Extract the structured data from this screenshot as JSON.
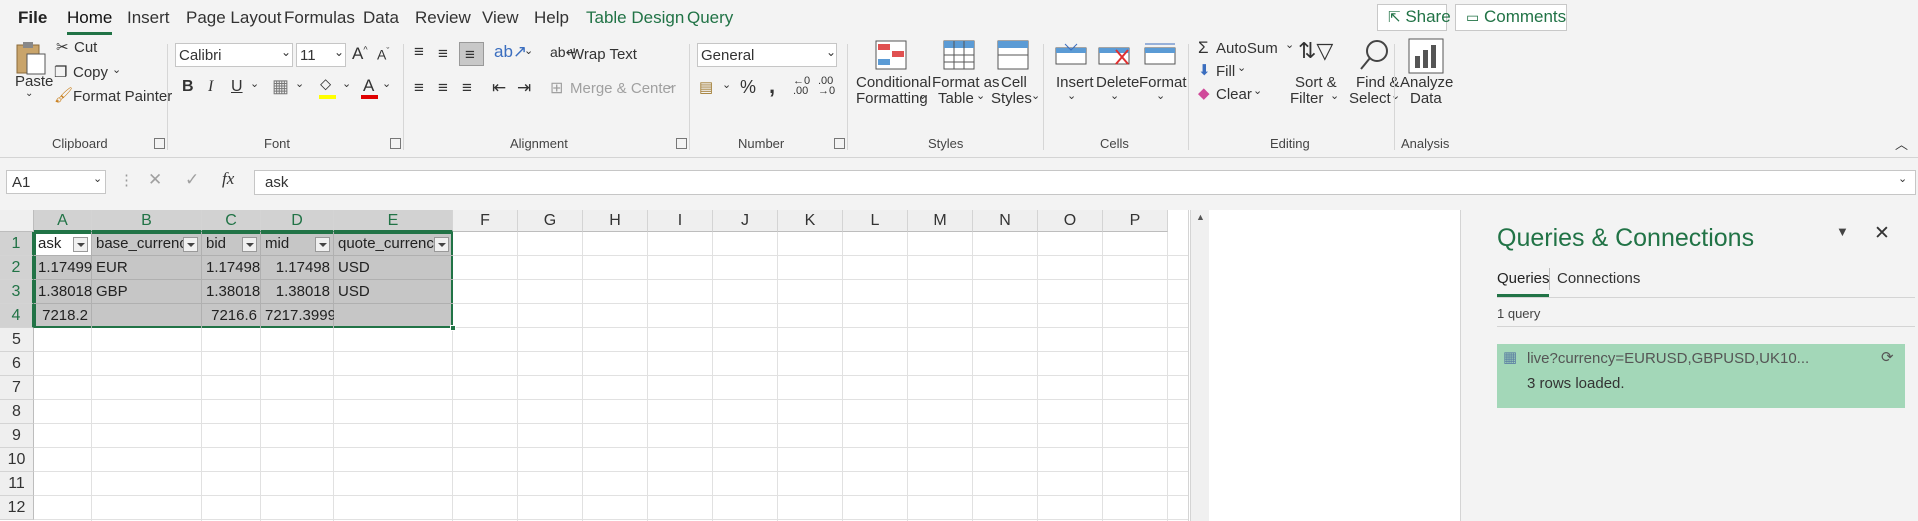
{
  "menu": {
    "file": "File",
    "tabs": [
      "Home",
      "Insert",
      "Page Layout",
      "Formulas",
      "Data",
      "Review",
      "View",
      "Help",
      "Table Design",
      "Query"
    ],
    "share": "Share",
    "comments": "Comments"
  },
  "ribbon": {
    "clipboard": {
      "paste": "Paste",
      "cut": "Cut",
      "copy": "Copy",
      "format_painter": "Format Painter",
      "label": "Clipboard"
    },
    "font": {
      "name": "Calibri",
      "size": "11",
      "bold": "B",
      "italic": "I",
      "underline": "U",
      "label": "Font"
    },
    "alignment": {
      "wrap_text": "Wrap Text",
      "merge_center": "Merge & Center",
      "label": "Alignment"
    },
    "number": {
      "format": "General",
      "percent": "%",
      "comma": ",",
      "label": "Number"
    },
    "styles": {
      "conditional": [
        "Conditional",
        "Formatting"
      ],
      "format_table": [
        "Format as",
        "Table"
      ],
      "cell_styles": [
        "Cell",
        "Styles"
      ],
      "label": "Styles"
    },
    "cells": {
      "insert": "Insert",
      "delete": "Delete",
      "format": "Format",
      "label": "Cells"
    },
    "editing": {
      "autosum": "AutoSum",
      "fill": "Fill",
      "clear": "Clear",
      "sort_filter": [
        "Sort &",
        "Filter"
      ],
      "find_select": [
        "Find &",
        "Select"
      ],
      "label": "Editing"
    },
    "analysis": {
      "analyze": [
        "Analyze",
        "Data"
      ],
      "label": "Analysis"
    }
  },
  "formula_bar": {
    "name_box": "A1",
    "fx": "fx",
    "value": "ask"
  },
  "sheet": {
    "columns": [
      "A",
      "B",
      "C",
      "D",
      "E",
      "F",
      "G",
      "H",
      "I",
      "J",
      "K",
      "L",
      "M",
      "N",
      "O",
      "P"
    ],
    "rows": [
      "1",
      "2",
      "3",
      "4",
      "5",
      "6",
      "7",
      "8",
      "9",
      "10",
      "11",
      "12"
    ],
    "table": {
      "headers": [
        "ask",
        "base_currency",
        "bid",
        "mid",
        "quote_currency"
      ],
      "rows": [
        [
          "1.17499",
          "EUR",
          "1.17498",
          "1.17498",
          "USD"
        ],
        [
          "1.38018",
          "GBP",
          "1.38018",
          "1.38018",
          "USD"
        ],
        [
          "7218.2",
          "",
          "7216.6",
          "7217.3999",
          ""
        ]
      ]
    }
  },
  "panel": {
    "title": "Queries & Connections",
    "tabs": [
      "Queries",
      "Connections"
    ],
    "count": "1 query",
    "query_name": "live?currency=EURUSD,GBPUSD,UK10...",
    "query_status": "3 rows loaded."
  }
}
